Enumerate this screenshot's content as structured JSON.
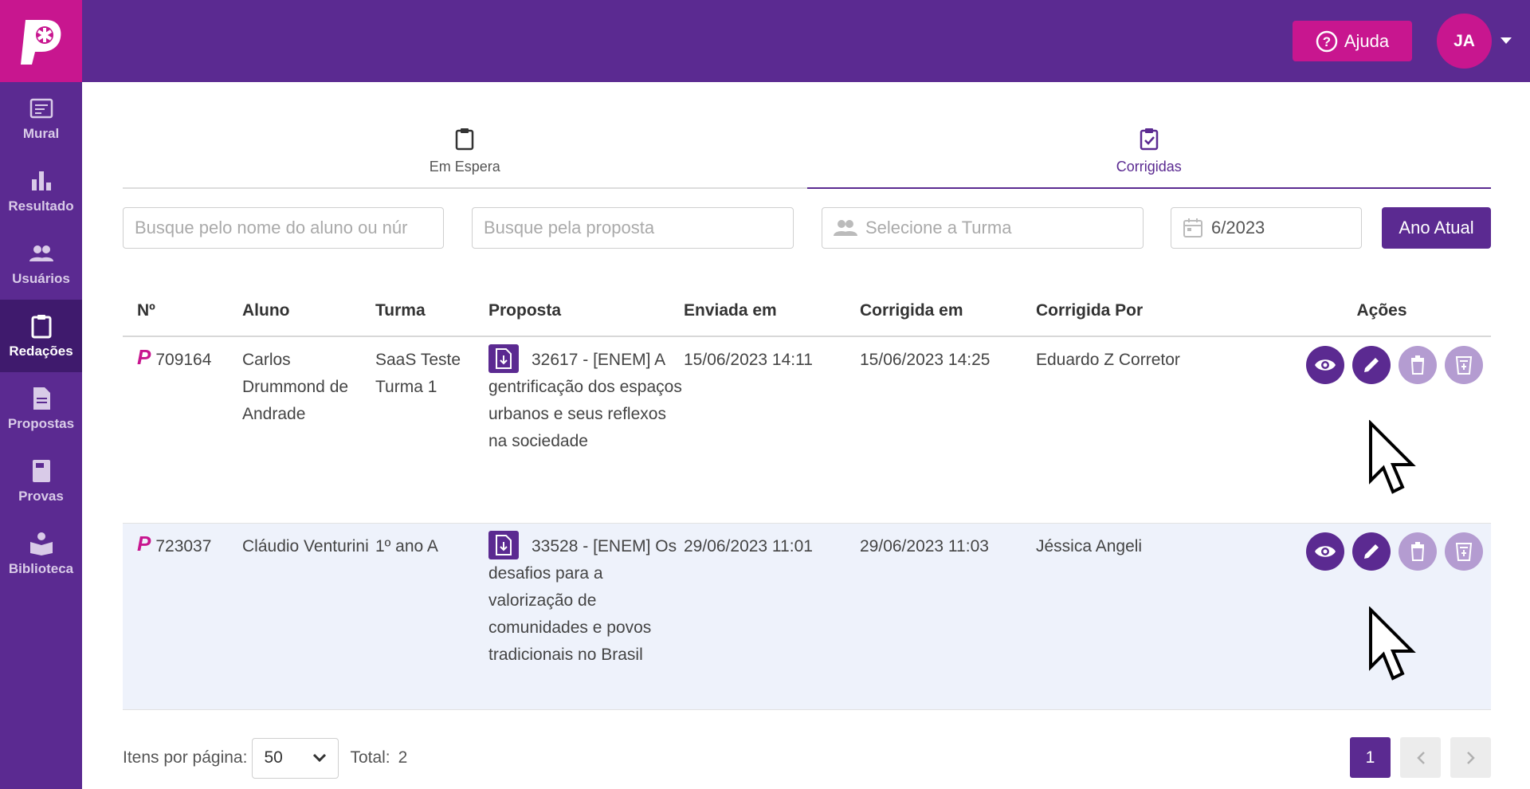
{
  "sidebar": {
    "logo_letter": "P",
    "items": [
      {
        "label": "Mural",
        "icon": "board-icon"
      },
      {
        "label": "Resultado",
        "icon": "bar-chart-icon"
      },
      {
        "label": "Usuários",
        "icon": "users-icon"
      },
      {
        "label": "Redações",
        "icon": "clipboard-icon",
        "active": true
      },
      {
        "label": "Propostas",
        "icon": "document-icon"
      },
      {
        "label": "Provas",
        "icon": "book-icon"
      },
      {
        "label": "Biblioteca",
        "icon": "reader-icon"
      }
    ]
  },
  "topbar": {
    "help_label": "Ajuda",
    "avatar_initials": "JA"
  },
  "tabs": [
    {
      "label": "Em Espera",
      "icon": "clipboard-icon",
      "active": false
    },
    {
      "label": "Corrigidas",
      "icon": "clipboard-check-icon",
      "active": true
    }
  ],
  "filters": {
    "student_placeholder": "Busque pelo nome do aluno ou núr",
    "proposal_placeholder": "Busque pela proposta",
    "class_placeholder": "Selecione a Turma",
    "date_value": "6/2023",
    "current_year_label": "Ano Atual"
  },
  "table": {
    "headers": [
      "Nº",
      "Aluno",
      "Turma",
      "Proposta",
      "Enviada em",
      "Corrigida em",
      "Corrigida Por",
      "Ações"
    ],
    "rows": [
      {
        "num": "709164",
        "student": "Carlos Drummond de Andrade",
        "class": "SaaS Teste Turma 1",
        "proposal_id": "32617 -",
        "proposal_text": "[ENEM] A gentrificação dos espaços urbanos e seus reflexos na sociedade",
        "sent": "15/06/2023 14:11",
        "corrected": "15/06/2023 14:25",
        "corrected_by": "Eduardo Z Corretor"
      },
      {
        "num": "723037",
        "student": "Cláudio Venturini",
        "class": "1º ano A",
        "proposal_id": "33528 -",
        "proposal_text": "[ENEM] Os desafios para a valorização de comunidades e povos tradicionais no Brasil",
        "sent": "29/06/2023 11:01",
        "corrected": "29/06/2023 11:03",
        "corrected_by": "Jéssica Angeli"
      }
    ]
  },
  "footer": {
    "per_page_label": "Itens por página:",
    "per_page_value": "50",
    "total_label": "Total:",
    "total_value": "2",
    "current_page": "1"
  },
  "colors": {
    "primary": "#5b2a91",
    "accent": "#c8168f",
    "row_alt": "#eef2fb"
  }
}
